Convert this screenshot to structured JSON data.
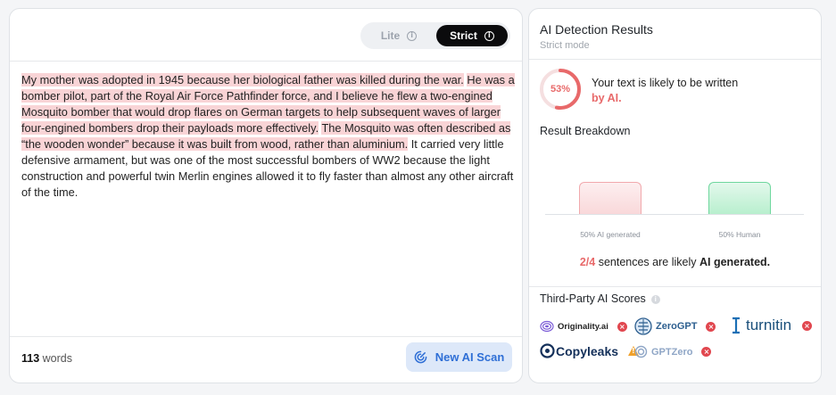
{
  "mode_toggle": {
    "lite_label": "Lite",
    "strict_label": "Strict",
    "selected": "Strict"
  },
  "editor": {
    "highlighted_sentences": [
      "My mother was adopted in 1945 because her biological father was killed during the war.",
      "He was a bomber pilot, part of the Royal Air Force Pathfinder force, and I believe he flew a two-engined Mosquito bomber that would drop flares on German targets to help subsequent waves of larger four-engined bombers drop their payloads more effectively.",
      "The Mosquito was often described as “the wooden wonder” because it was built from wood, rather than aluminium."
    ],
    "plain_text": "It carried very little defensive armament, but was one of the most successful bombers of WW2 because the light construction and powerful twin Merlin engines allowed it to fly faster than almost any other aircraft of the time.",
    "word_count": "113",
    "word_count_label": "words",
    "scan_button_label": "New AI Scan"
  },
  "results": {
    "title": "AI Detection Results",
    "subtitle": "Strict mode",
    "ai_percent": 53,
    "ai_percent_label": "53%",
    "verdict_line1": "Your text is likely to be written",
    "verdict_line2": "by AI.",
    "breakdown_title": "Result Breakdown",
    "breakdown": {
      "ai_label": "50% AI generated",
      "human_label": "50% Human",
      "ai_value": 50,
      "human_value": 50
    },
    "sentences_count": "2/4",
    "sentences_text": "sentences are likely",
    "sentences_strong": "AI generated.",
    "third_party_title": "Third-Party AI Scores",
    "third_party": [
      {
        "name": "Originality.ai",
        "status": "fail",
        "icon": "originality-logo-icon"
      },
      {
        "name": "ZeroGPT",
        "status": "fail",
        "icon": "zerogpt-logo-icon"
      },
      {
        "name": "turnitin",
        "status": "fail",
        "icon": "turnitin-logo-icon"
      },
      {
        "name": "Copyleaks",
        "status": "warning",
        "icon": "copyleaks-logo-icon"
      },
      {
        "name": "GPTZero",
        "status": "fail",
        "icon": "gptzero-logo-icon"
      }
    ]
  },
  "colors": {
    "ai_red": "#e8696a",
    "highlight": "#f9d4d6",
    "human_green": "#6fd79e",
    "accent_blue": "#2f6fd6",
    "fail_red": "#e1474f",
    "warning_orange": "#f0a12b"
  }
}
